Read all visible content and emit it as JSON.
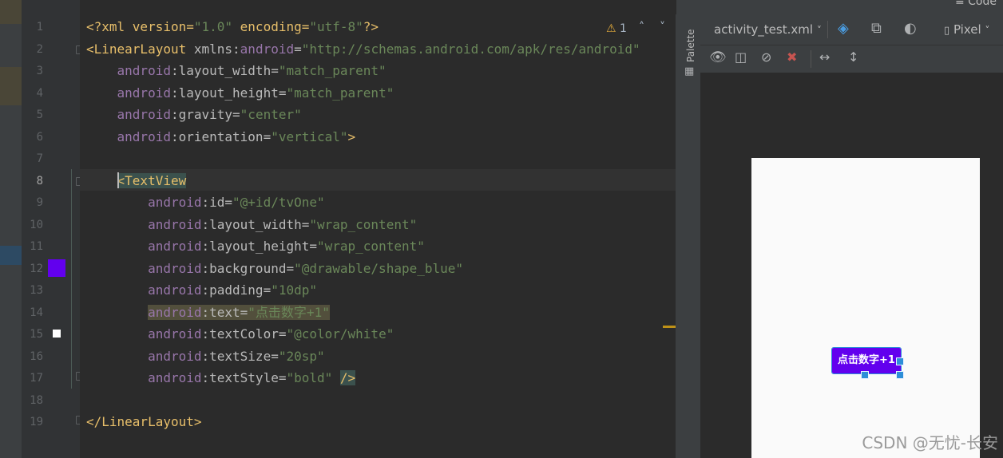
{
  "top": {
    "mode_label": "Code"
  },
  "editor": {
    "line_numbers": [
      "1",
      "2",
      "3",
      "4",
      "5",
      "6",
      "7",
      "8",
      "9",
      "10",
      "11",
      "12",
      "13",
      "14",
      "15",
      "16",
      "17",
      "18",
      "19"
    ],
    "warning": {
      "icon": "warning-triangle-icon",
      "count": "1"
    },
    "lines": [
      [
        {
          "t": "<?xml version=",
          "c": "tag"
        },
        {
          "t": "\"1.0\"",
          "c": "val"
        },
        {
          "t": " encoding=",
          "c": "tag"
        },
        {
          "t": "\"utf-8\"",
          "c": "val"
        },
        {
          "t": "?>",
          "c": "tag"
        }
      ],
      [
        {
          "t": "<LinearLayout",
          "c": "tag"
        },
        {
          "t": " xmlns:",
          "c": "attr"
        },
        {
          "t": "android",
          "c": "ns"
        },
        {
          "t": "=",
          "c": "punc"
        },
        {
          "t": "\"http://schemas.android.com/apk/res/android\"",
          "c": "val"
        }
      ],
      [
        {
          "t": "    android",
          "c": "ns"
        },
        {
          "t": ":layout_width=",
          "c": "attr"
        },
        {
          "t": "\"match_parent\"",
          "c": "val"
        }
      ],
      [
        {
          "t": "    android",
          "c": "ns"
        },
        {
          "t": ":layout_height=",
          "c": "attr"
        },
        {
          "t": "\"match_parent\"",
          "c": "val"
        }
      ],
      [
        {
          "t": "    android",
          "c": "ns"
        },
        {
          "t": ":gravity=",
          "c": "attr"
        },
        {
          "t": "\"center\"",
          "c": "val"
        }
      ],
      [
        {
          "t": "    android",
          "c": "ns"
        },
        {
          "t": ":orientation=",
          "c": "attr"
        },
        {
          "t": "\"vertical\"",
          "c": "val"
        },
        {
          "t": ">",
          "c": "tag"
        }
      ],
      [],
      [
        {
          "t": "    ",
          "c": "punc"
        },
        {
          "t": "<TextView",
          "c": "tag",
          "h": "tag"
        }
      ],
      [
        {
          "t": "        android",
          "c": "ns"
        },
        {
          "t": ":id=",
          "c": "attr"
        },
        {
          "t": "\"@+id/tvOne\"",
          "c": "val"
        }
      ],
      [
        {
          "t": "        android",
          "c": "ns"
        },
        {
          "t": ":layout_width=",
          "c": "attr"
        },
        {
          "t": "\"wrap_content\"",
          "c": "val"
        }
      ],
      [
        {
          "t": "        android",
          "c": "ns"
        },
        {
          "t": ":layout_height=",
          "c": "attr"
        },
        {
          "t": "\"wrap_content\"",
          "c": "val"
        }
      ],
      [
        {
          "t": "        android",
          "c": "ns"
        },
        {
          "t": ":background=",
          "c": "attr"
        },
        {
          "t": "\"@drawable/shape_blue\"",
          "c": "val"
        }
      ],
      [
        {
          "t": "        android",
          "c": "ns"
        },
        {
          "t": ":padding=",
          "c": "attr"
        },
        {
          "t": "\"10dp\"",
          "c": "val"
        }
      ],
      [
        {
          "t": "        ",
          "c": "punc"
        },
        {
          "t": "android",
          "c": "ns",
          "h": "attr"
        },
        {
          "t": ":text=",
          "c": "attr",
          "h": "attr"
        },
        {
          "t": "\"点击数字+1\"",
          "c": "val",
          "h": "attr"
        }
      ],
      [
        {
          "t": "        android",
          "c": "ns"
        },
        {
          "t": ":textColor=",
          "c": "attr"
        },
        {
          "t": "\"@color/white\"",
          "c": "val"
        }
      ],
      [
        {
          "t": "        android",
          "c": "ns"
        },
        {
          "t": ":textSize=",
          "c": "attr"
        },
        {
          "t": "\"20sp\"",
          "c": "val"
        }
      ],
      [
        {
          "t": "        android",
          "c": "ns"
        },
        {
          "t": ":textStyle=",
          "c": "attr"
        },
        {
          "t": "\"bold\"",
          "c": "val"
        },
        {
          "t": " ",
          "c": "punc"
        },
        {
          "t": "/>",
          "c": "tag",
          "h": "tag"
        }
      ],
      [],
      [
        {
          "t": "</LinearLayout>",
          "c": "tag"
        }
      ]
    ],
    "swatches": {
      "line12": "#6200ee",
      "line15": "#ffffff"
    }
  },
  "palette": {
    "label": "Palette"
  },
  "design": {
    "file_selector": "activity_test.xml",
    "device_selector": "Pixel",
    "preview_text": "点击数字+1",
    "preview_bg": "#6200ee",
    "watermark": "CSDN @无忧-长安"
  },
  "colors": {
    "tag": "#e8bf6a",
    "attr": "#bababa",
    "ns": "#9876aa",
    "val": "#6a8759",
    "editor_bg": "#2b2b2b"
  }
}
